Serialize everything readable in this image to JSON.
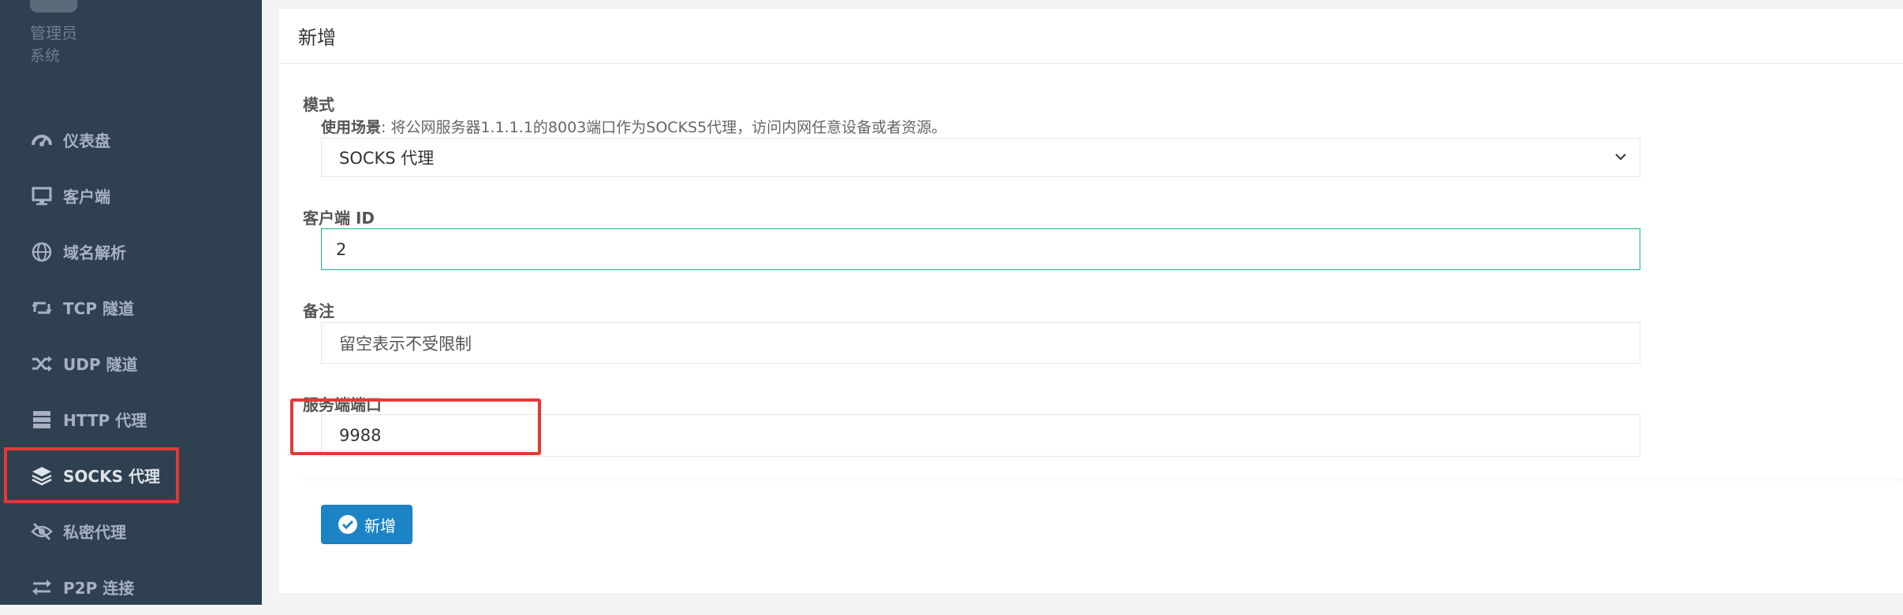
{
  "sidebar": {
    "profile_name": "管理员",
    "profile_role": "系统",
    "items": [
      {
        "label": "仪表盘",
        "icon": "dashboard-icon"
      },
      {
        "label": "客户端",
        "icon": "desktop-icon"
      },
      {
        "label": "域名解析",
        "icon": "globe-icon"
      },
      {
        "label": "TCP 隧道",
        "icon": "retweet-icon"
      },
      {
        "label": "UDP 隧道",
        "icon": "random-icon"
      },
      {
        "label": "HTTP 代理",
        "icon": "server-icon"
      },
      {
        "label": "SOCKS 代理",
        "icon": "layers-icon",
        "highlighted": true
      },
      {
        "label": "私密代理",
        "icon": "eye-slash-icon"
      },
      {
        "label": "P2P 连接",
        "icon": "exchange-icon"
      }
    ]
  },
  "form": {
    "title": "新增",
    "mode_label": "模式",
    "usage_bold": "使用场景",
    "usage_text": ": 将公网服务器1.1.1.1的8003端口作为SOCKS5代理，访问内网任意设备或者资源。",
    "mode_value": "SOCKS 代理",
    "client_id_label": "客户端 ID",
    "client_id_value": "2",
    "remark_label": "备注",
    "remark_placeholder": "留空表示不受限制",
    "port_label": "服务端端口",
    "port_value": "9988",
    "submit_label": "新增"
  },
  "colors": {
    "sidebar_bg": "#2f4050",
    "sidebar_text": "#a7b1c2",
    "focus_border": "#1ab394",
    "primary_button": "#1c84c6",
    "annotation_red": "#e53935"
  }
}
